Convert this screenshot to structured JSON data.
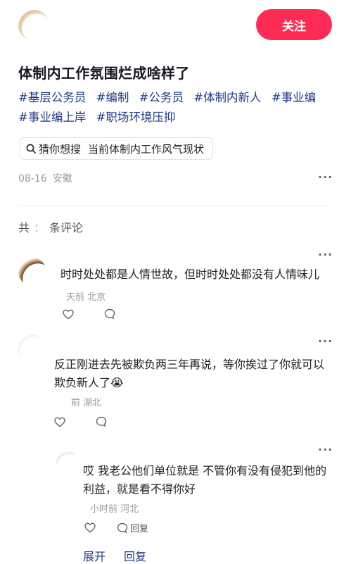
{
  "header": {
    "follow_label": "关注"
  },
  "post": {
    "title": "体制内工作氛围烂成啥样了",
    "hashtags": [
      "#基层公务员",
      "#编制",
      "#公务员",
      "#体制内新人",
      "#事业编",
      "#事业编上岸",
      "#职场环境压抑"
    ],
    "search_prefix": "猜你想搜",
    "search_query": "当前体制内工作风气现状",
    "date": "08-16",
    "location": "安徽",
    "more": "···"
  },
  "comments_header": {
    "prefix": "共",
    "middle": "：",
    "suffix": "条评论"
  },
  "comments": [
    {
      "text": "时时处处都是人情世故，但时时处处都没有人情味儿",
      "time": "天前",
      "location": "北京",
      "more": "···"
    },
    {
      "text_line1": "反正刚进去先被欺负两三年再说，等你挨过了你就可以",
      "text_line2": "欺负新人了",
      "emoji": "😭",
      "time": "前",
      "location": "湖北",
      "more": "···"
    },
    {
      "text_line1": "哎 我老公他们单位就是 不管你有没有侵犯到他的",
      "text_line2": "利益，就是看不得你好",
      "time": "小时前",
      "location": "河北",
      "reply_label": "回复",
      "more": "···"
    }
  ],
  "footer": {
    "expand_label": "展开",
    "reply_label": "回复"
  },
  "colors": {
    "accent": "#fe2c55",
    "hashtag": "#1e3a8a"
  }
}
